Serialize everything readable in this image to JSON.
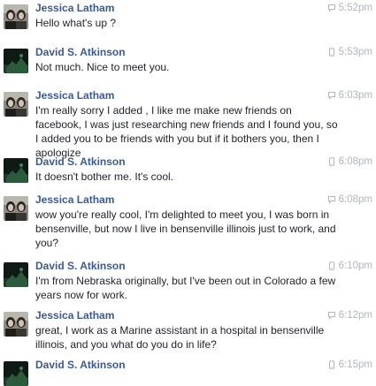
{
  "colors": {
    "name": "#3b5998",
    "text": "#1d2129",
    "timestamp": "#b0b5bf"
  },
  "messages": [
    {
      "sender": "Jessica Latham",
      "time": "5:52pm",
      "text": "Hello what's up ?",
      "device_icon": "chat-bubble-icon"
    },
    {
      "sender": "David S. Atkinson",
      "time": "5:53pm",
      "text": "Not much. Nice to meet you.",
      "device_icon": "mobile-phone-icon"
    },
    {
      "sender": "Jessica Latham",
      "time": "6:03pm",
      "text": "I'm really sorry I added , I like me make new friends on facebook, I was just researching new friends and I found you, so I added you to be friends with you but if it bothers you, then I apologize",
      "device_icon": "chat-bubble-icon"
    },
    {
      "sender": "David S. Atkinson",
      "time": "6:08pm",
      "text": "It doesn't bother me. It's cool.",
      "device_icon": "mobile-phone-icon"
    },
    {
      "sender": "Jessica Latham",
      "time": "6:08pm",
      "text": "wow   you're really cool, I'm delighted to meet you, I was born in bensenville, but now I live in bensenville illinois just to work, and you?",
      "device_icon": "chat-bubble-icon"
    },
    {
      "sender": "David S. Atkinson",
      "time": "6:10pm",
      "text": "I'm from Nebraska originally, but I've been out in Colorado a few years now for work.",
      "device_icon": "mobile-phone-icon"
    },
    {
      "sender": "Jessica Latham",
      "time": "6:12pm",
      "text": "great,  I work as a Marine assistant in a hospital in bensenville illinois, and you what do you do in life?",
      "device_icon": "chat-bubble-icon"
    },
    {
      "sender": "David S. Atkinson",
      "time": "6:15pm",
      "text": "",
      "device_icon": "mobile-phone-icon"
    }
  ]
}
